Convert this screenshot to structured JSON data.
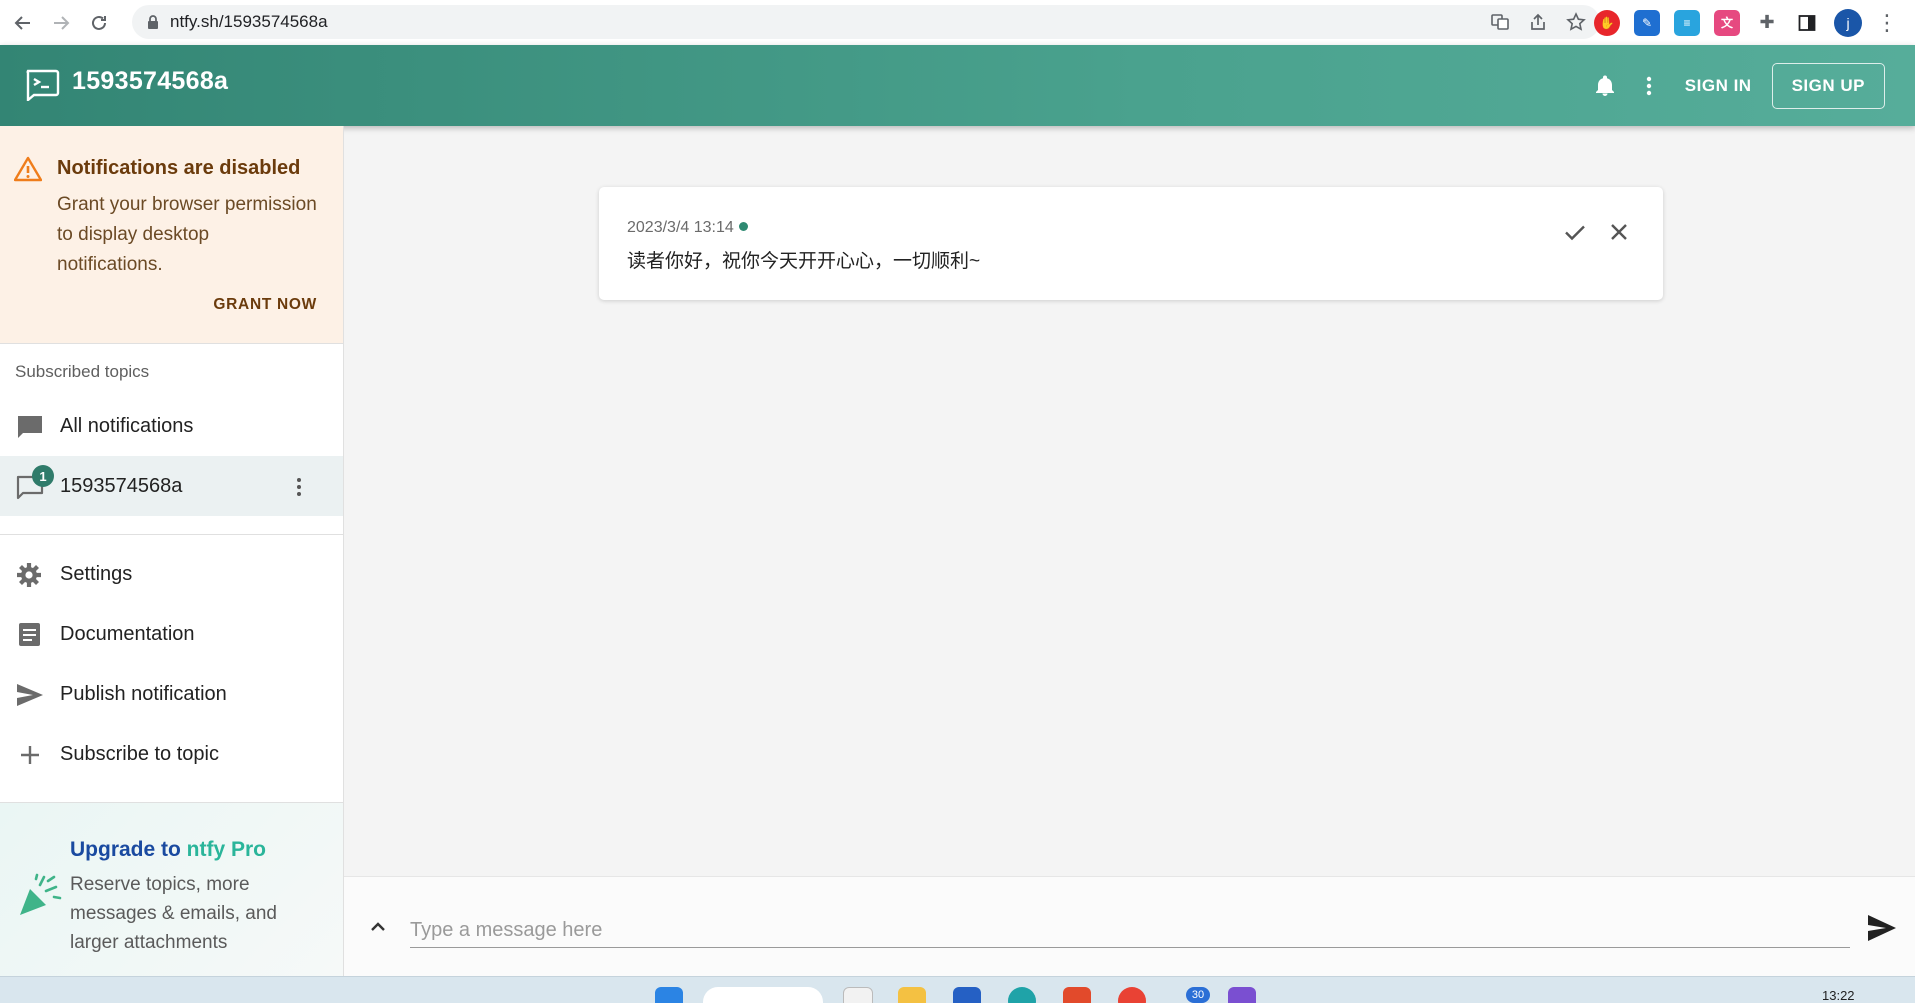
{
  "browser": {
    "url": "ntfy.sh/1593574568a",
    "profile_initial": "j"
  },
  "app": {
    "title": "1593574568a",
    "sign_in": "SIGN IN",
    "sign_up": "SIGN UP",
    "accent": "#338574"
  },
  "alert": {
    "title": "Notifications are disabled",
    "body": "Grant your browser permission to display desktop notifications.",
    "action": "GRANT NOW"
  },
  "sidebar": {
    "subheader": "Subscribed topics",
    "all_notifications": "All notifications",
    "topic": {
      "name": "1593574568a",
      "unread": "1"
    },
    "settings": "Settings",
    "documentation": "Documentation",
    "publish": "Publish notification",
    "subscribe": "Subscribe to topic"
  },
  "upgrade": {
    "title_part1": "Upgrade to ",
    "title_part2": "ntfy Pro",
    "body": "Reserve topics, more messages & emails, and larger attachments"
  },
  "notification": {
    "time": "2023/3/4 13:14",
    "message": "读者你好，祝你今天开开心心，一切顺利~"
  },
  "composer": {
    "placeholder": "Type a message here"
  },
  "taskbar": {
    "badge_count": "30",
    "clock": "13:22"
  }
}
